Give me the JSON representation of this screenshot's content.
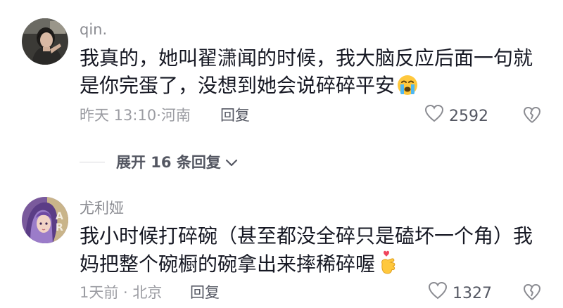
{
  "comments": [
    {
      "username": "qin.",
      "text": "我真的，她叫翟潇闻的时候，我大脑反应后面一句就是你完蛋了，没想到她会说碎碎平安",
      "emoji": "crying-face-emoji",
      "time_location": "昨天 13:10·河南",
      "reply_label": "回复",
      "likes": "2592",
      "avatar": "user-photo-avatar"
    },
    {
      "username": "尤利娅",
      "text": "我小时候打碎碗（甚至都没全碎只是磕坏一个角）我妈把整个碗橱的碗拿出来摔稀碎喔",
      "emoji": "finger-heart-emoji",
      "time_location": "1天前 · 北京",
      "reply_label": "回复",
      "likes": "1327",
      "avatar": "anime-character-avatar"
    }
  ],
  "expand_replies": {
    "label": "展开 16 条回复",
    "icon": "chevron-down-icon"
  },
  "colors": {
    "primary_text": "#161823",
    "secondary_text": "#8a8b91",
    "action_text": "#545762"
  }
}
